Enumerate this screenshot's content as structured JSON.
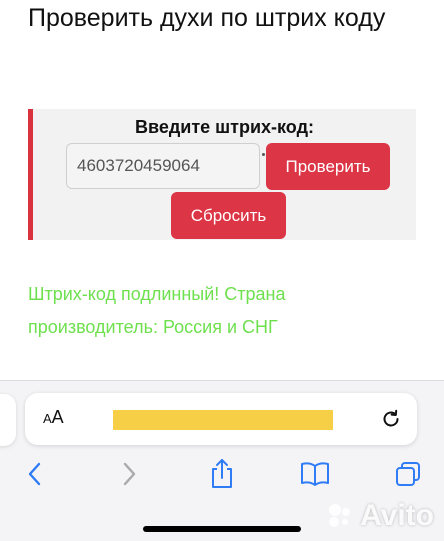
{
  "page": {
    "title": "Проверить духи по штрих коду"
  },
  "checker": {
    "label": "Введите штрих-код:",
    "barcode_value": "4603720459064",
    "check_button": "Проверить",
    "reset_button": "Сбросить"
  },
  "result": {
    "message": "Штрих-код подлинный! Страна производитель: Россия и СНГ"
  },
  "browser": {
    "aa_label": "AA",
    "url_redacted": true
  },
  "watermark": {
    "text": "Avito"
  },
  "colors": {
    "accent_red": "#dc3545",
    "success_green": "#6ee04e",
    "ios_blue": "#2f7cf6",
    "redaction_yellow": "#f7cf47"
  },
  "icons": {
    "back": "chevron-left-icon",
    "forward": "chevron-right-icon",
    "share": "share-icon",
    "bookmarks": "book-icon",
    "tabs": "tabs-icon",
    "reload": "reload-icon"
  }
}
